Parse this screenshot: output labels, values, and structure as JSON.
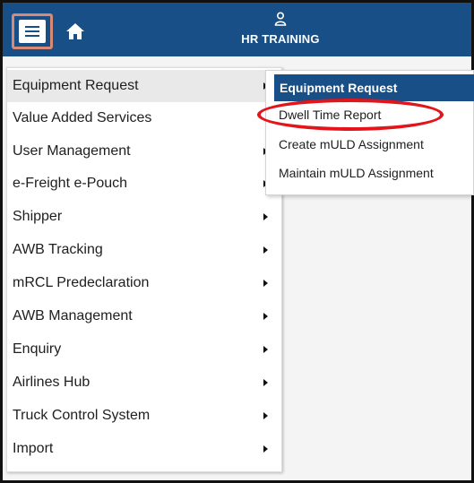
{
  "header": {
    "app_title": "HR TRAINING",
    "menu_icon": "hamburger-icon",
    "home_icon": "home-icon",
    "user_icon": "user-icon",
    "accent_color": "#184f86"
  },
  "main_menu": {
    "items": [
      {
        "label": "Equipment Request",
        "active": true
      },
      {
        "label": "Value Added Services",
        "active": false
      },
      {
        "label": "User Management",
        "active": false
      },
      {
        "label": "e-Freight e-Pouch",
        "active": false
      },
      {
        "label": "Shipper",
        "active": false
      },
      {
        "label": "AWB Tracking",
        "active": false
      },
      {
        "label": "mRCL Predeclaration",
        "active": false
      },
      {
        "label": "AWB Management",
        "active": false
      },
      {
        "label": "Enquiry",
        "active": false
      },
      {
        "label": "Airlines Hub",
        "active": false
      },
      {
        "label": "Truck Control System",
        "active": false
      },
      {
        "label": "Import",
        "active": false
      }
    ]
  },
  "sub_menu": {
    "header": "Equipment Request",
    "items": [
      {
        "label": "Dwell Time Report",
        "highlighted": true
      },
      {
        "label": "Create mULD Assignment",
        "highlighted": false
      },
      {
        "label": "Maintain mULD Assignment",
        "highlighted": false
      }
    ],
    "highlight_color": "#e1151a"
  }
}
